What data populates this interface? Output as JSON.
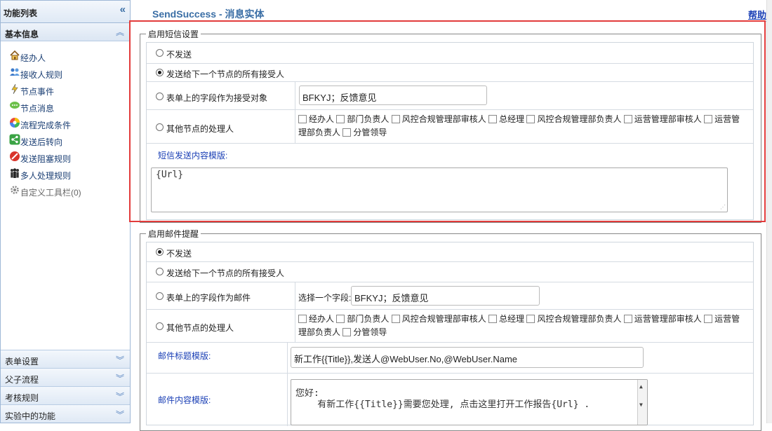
{
  "sidebar": {
    "header": "功能列表",
    "collapse_glyph": "«",
    "panel_title": "基本信息",
    "panel_glyph": "︽",
    "items": [
      {
        "label": "经办人",
        "icon": "home-icon"
      },
      {
        "label": "接收人规则",
        "icon": "users-icon"
      },
      {
        "label": "节点事件",
        "icon": "lightning-icon"
      },
      {
        "label": "节点消息",
        "icon": "chat-icon"
      },
      {
        "label": "流程完成条件",
        "icon": "color-wheel-icon"
      },
      {
        "label": "发送后转向",
        "icon": "share-icon"
      },
      {
        "label": "发送阻塞规则",
        "icon": "block-icon"
      },
      {
        "label": "多人处理规则",
        "icon": "group-icon"
      },
      {
        "label": "自定义工具栏(0)",
        "icon": "gear-icon"
      }
    ],
    "bottom_panels": [
      "表单设置",
      "父子流程",
      "考核规则",
      "实验中的功能"
    ],
    "bottom_glyph": "︾"
  },
  "header": {
    "title": "SendSuccess - 消息实体",
    "help": "帮助"
  },
  "sms": {
    "legend": "启用短信设置",
    "opt_none": "不发送",
    "opt_next": "发送给下一个节点的所有接受人",
    "opt_field": "表单上的字段作为接受对象",
    "field_value": "BFKYJ；反馈意见",
    "opt_others": "其他节点的处理人",
    "template_label": "短信发送内容模版:",
    "template_value": "{Url}",
    "selected": "next"
  },
  "mail": {
    "legend": "启用邮件提醒",
    "opt_none": "不发送",
    "opt_next": "发送给下一个节点的所有接受人",
    "opt_field": "表单上的字段作为邮件",
    "field_prefix": "选择一个字段:",
    "field_value": "BFKYJ；反馈意见",
    "opt_others": "其他节点的处理人",
    "subject_label": "邮件标题模版:",
    "subject_value": "新工作{{Title}},发送人@WebUser.No,@WebUser.Name",
    "body_label": "邮件内容模版:",
    "body_line1": "您好:",
    "body_line2": "    有新工作{{Title}}需要您处理, 点击这里打开工作报告{Url} .",
    "selected": "none"
  },
  "handlers": {
    "items": [
      "经办人",
      "部门负责人",
      "风控合规管理部审核人",
      "总经理",
      "风控合规管理部负责人",
      "运营管理部审核人",
      "运营管理部负责人",
      "分管领导"
    ],
    "line1_tail": "运营管",
    "line2_head": "理部负责人"
  }
}
